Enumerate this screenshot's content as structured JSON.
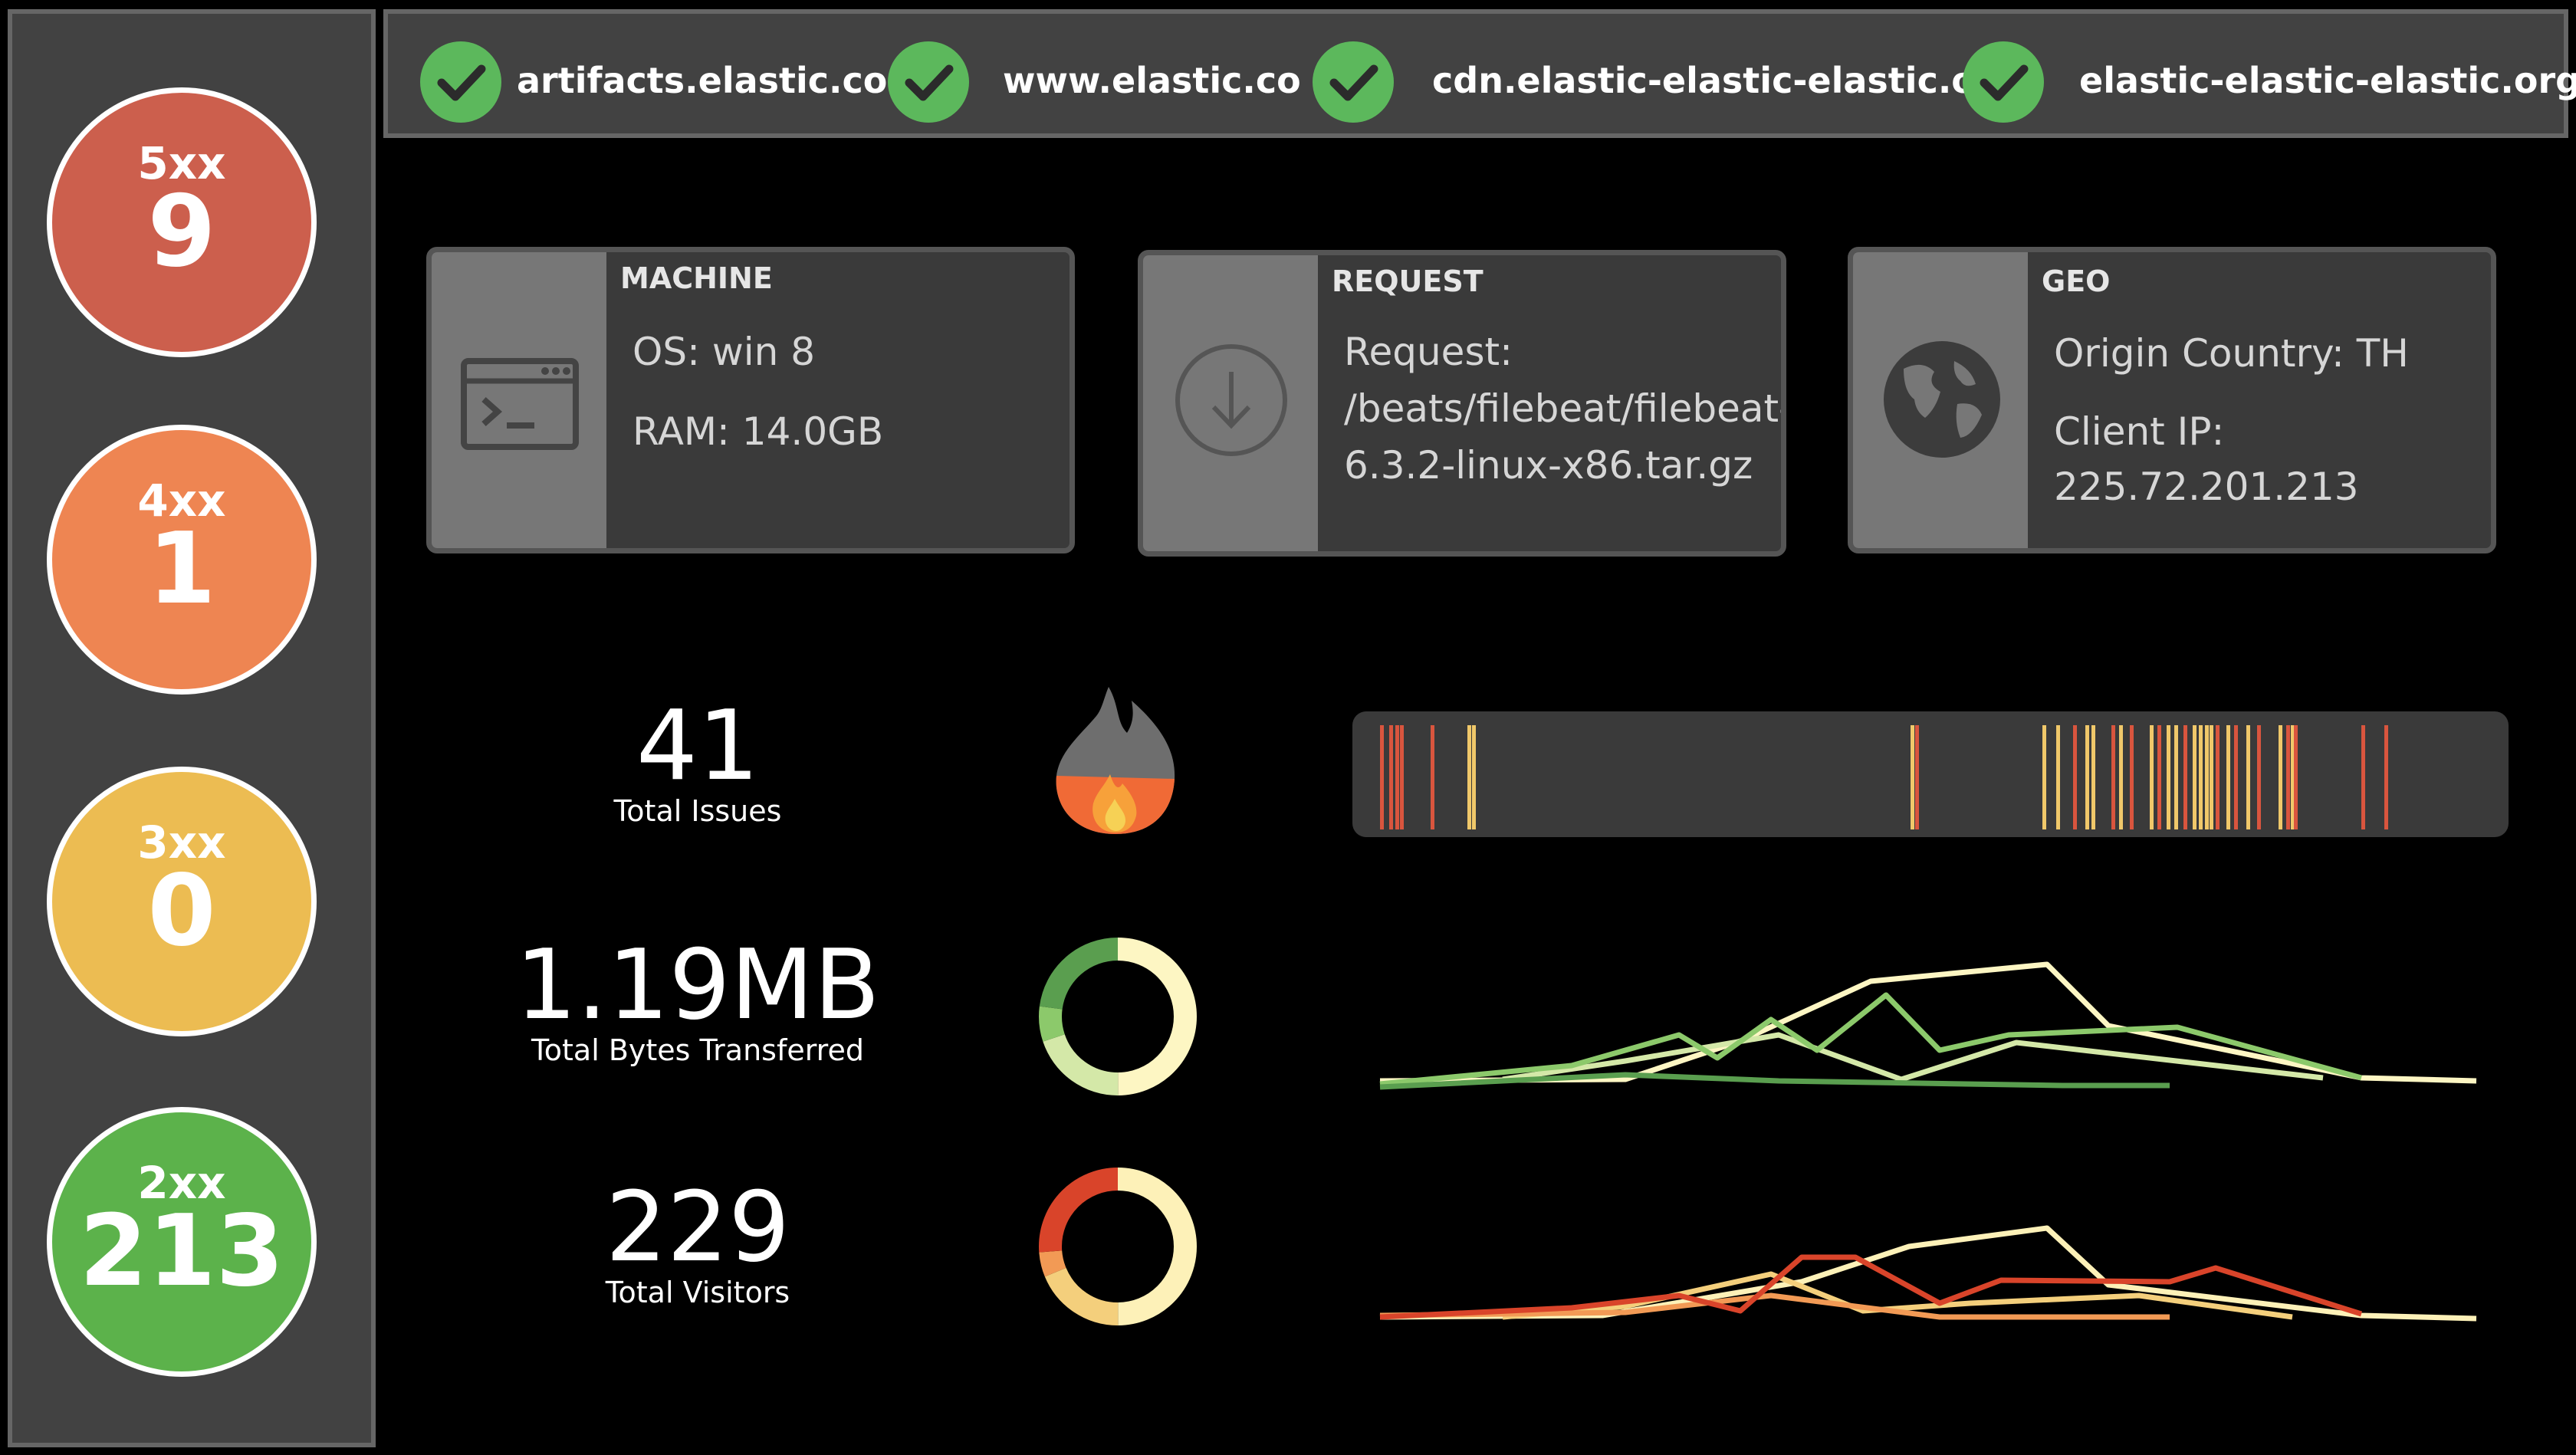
{
  "status_codes": [
    {
      "code": "5xx",
      "count": "9",
      "color": "#cc5f4d"
    },
    {
      "code": "4xx",
      "count": "1",
      "color": "#ee8552"
    },
    {
      "code": "3xx",
      "count": "0",
      "color": "#ecbc52"
    },
    {
      "code": "2xx",
      "count": "213",
      "color": "#5cb24b"
    }
  ],
  "checks": [
    {
      "host": "artifacts.elastic.co",
      "status_icon": "check-icon"
    },
    {
      "host": "www.elastic.co",
      "status_icon": "check-icon"
    },
    {
      "host": "cdn.elastic-elastic-elastic.org",
      "status_icon": "check-icon"
    },
    {
      "host": "elastic-elastic-elastic.org",
      "status_icon": "check-icon"
    }
  ],
  "panels": {
    "machine": {
      "title": "MACHINE",
      "icon": "terminal-window-icon",
      "os": "OS: win 8",
      "ram": "RAM: 14.0GB"
    },
    "request": {
      "title": "REQUEST",
      "icon": "download-icon",
      "line1": "Request:",
      "line2": "/beats/filebeat/filebeat-",
      "line3": "6.3.2-linux-x86.tar.gz"
    },
    "geo": {
      "title": "GEO",
      "icon": "globe-icon",
      "country": "Origin Country: TH",
      "ip_label": "Client IP:",
      "ip": "225.72.201.213"
    }
  },
  "kpis": {
    "issues": {
      "value": "41",
      "label": "Total Issues",
      "icon": "fire-icon"
    },
    "bytes": {
      "value": "1.19MB",
      "label": "Total Bytes Transferred",
      "icon": "donut-ring-icon"
    },
    "visitors": {
      "value": "229",
      "label": "Total Visitors",
      "icon": "donut-ring-icon"
    }
  },
  "colors": {
    "check_green": "#5cb85c",
    "panel_bg": "#3a3a3a",
    "strip_red": "#d9553e",
    "strip_yellow": "#f0c86a",
    "greens": [
      "#5a9e4f",
      "#8cc96b",
      "#d4e8a8",
      "#fdf6c3"
    ],
    "reds": [
      "#d9442a",
      "#f29a55",
      "#f4cf7c",
      "#fdf1b8"
    ]
  }
}
